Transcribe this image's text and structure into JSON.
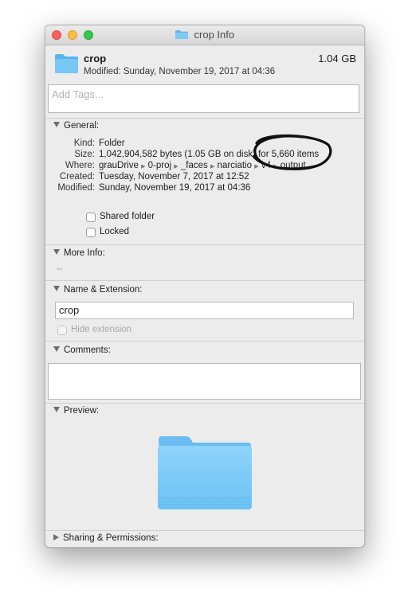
{
  "window": {
    "title": "crop Info",
    "colors": {
      "close": "#fc605c",
      "minimize": "#fdbc40",
      "maximize": "#34c84a",
      "folder": "#6ec6f5"
    }
  },
  "header": {
    "name": "crop",
    "modified": "Modified: Sunday, November 19, 2017 at 04:36",
    "size": "1.04 GB"
  },
  "tags": {
    "placeholder": "Add Tags..."
  },
  "general": {
    "title": "General:",
    "rows": [
      {
        "label": "Kind:",
        "value": "Folder"
      },
      {
        "label": "Size:",
        "value": "1,042,904,582 bytes (1.05 GB on disk) for 5,660 items"
      },
      {
        "label": "Where:",
        "path": [
          "grauDrive",
          "0-proj",
          "_faces",
          "narciatio",
          "v4",
          "output"
        ]
      },
      {
        "label": "Created:",
        "value": "Tuesday, November 7, 2017 at 12:52"
      },
      {
        "label": "Modified:",
        "value": "Sunday, November 19, 2017 at 04:36"
      }
    ],
    "shared_folder": "Shared folder",
    "locked": "Locked"
  },
  "more_info": {
    "title": "More Info:",
    "value": "--"
  },
  "name_extension": {
    "title": "Name & Extension:",
    "name_value": "crop",
    "hide_extension": "Hide extension"
  },
  "comments": {
    "title": "Comments:"
  },
  "preview": {
    "title": "Preview:"
  },
  "sharing": {
    "title": "Sharing & Permissions:"
  }
}
